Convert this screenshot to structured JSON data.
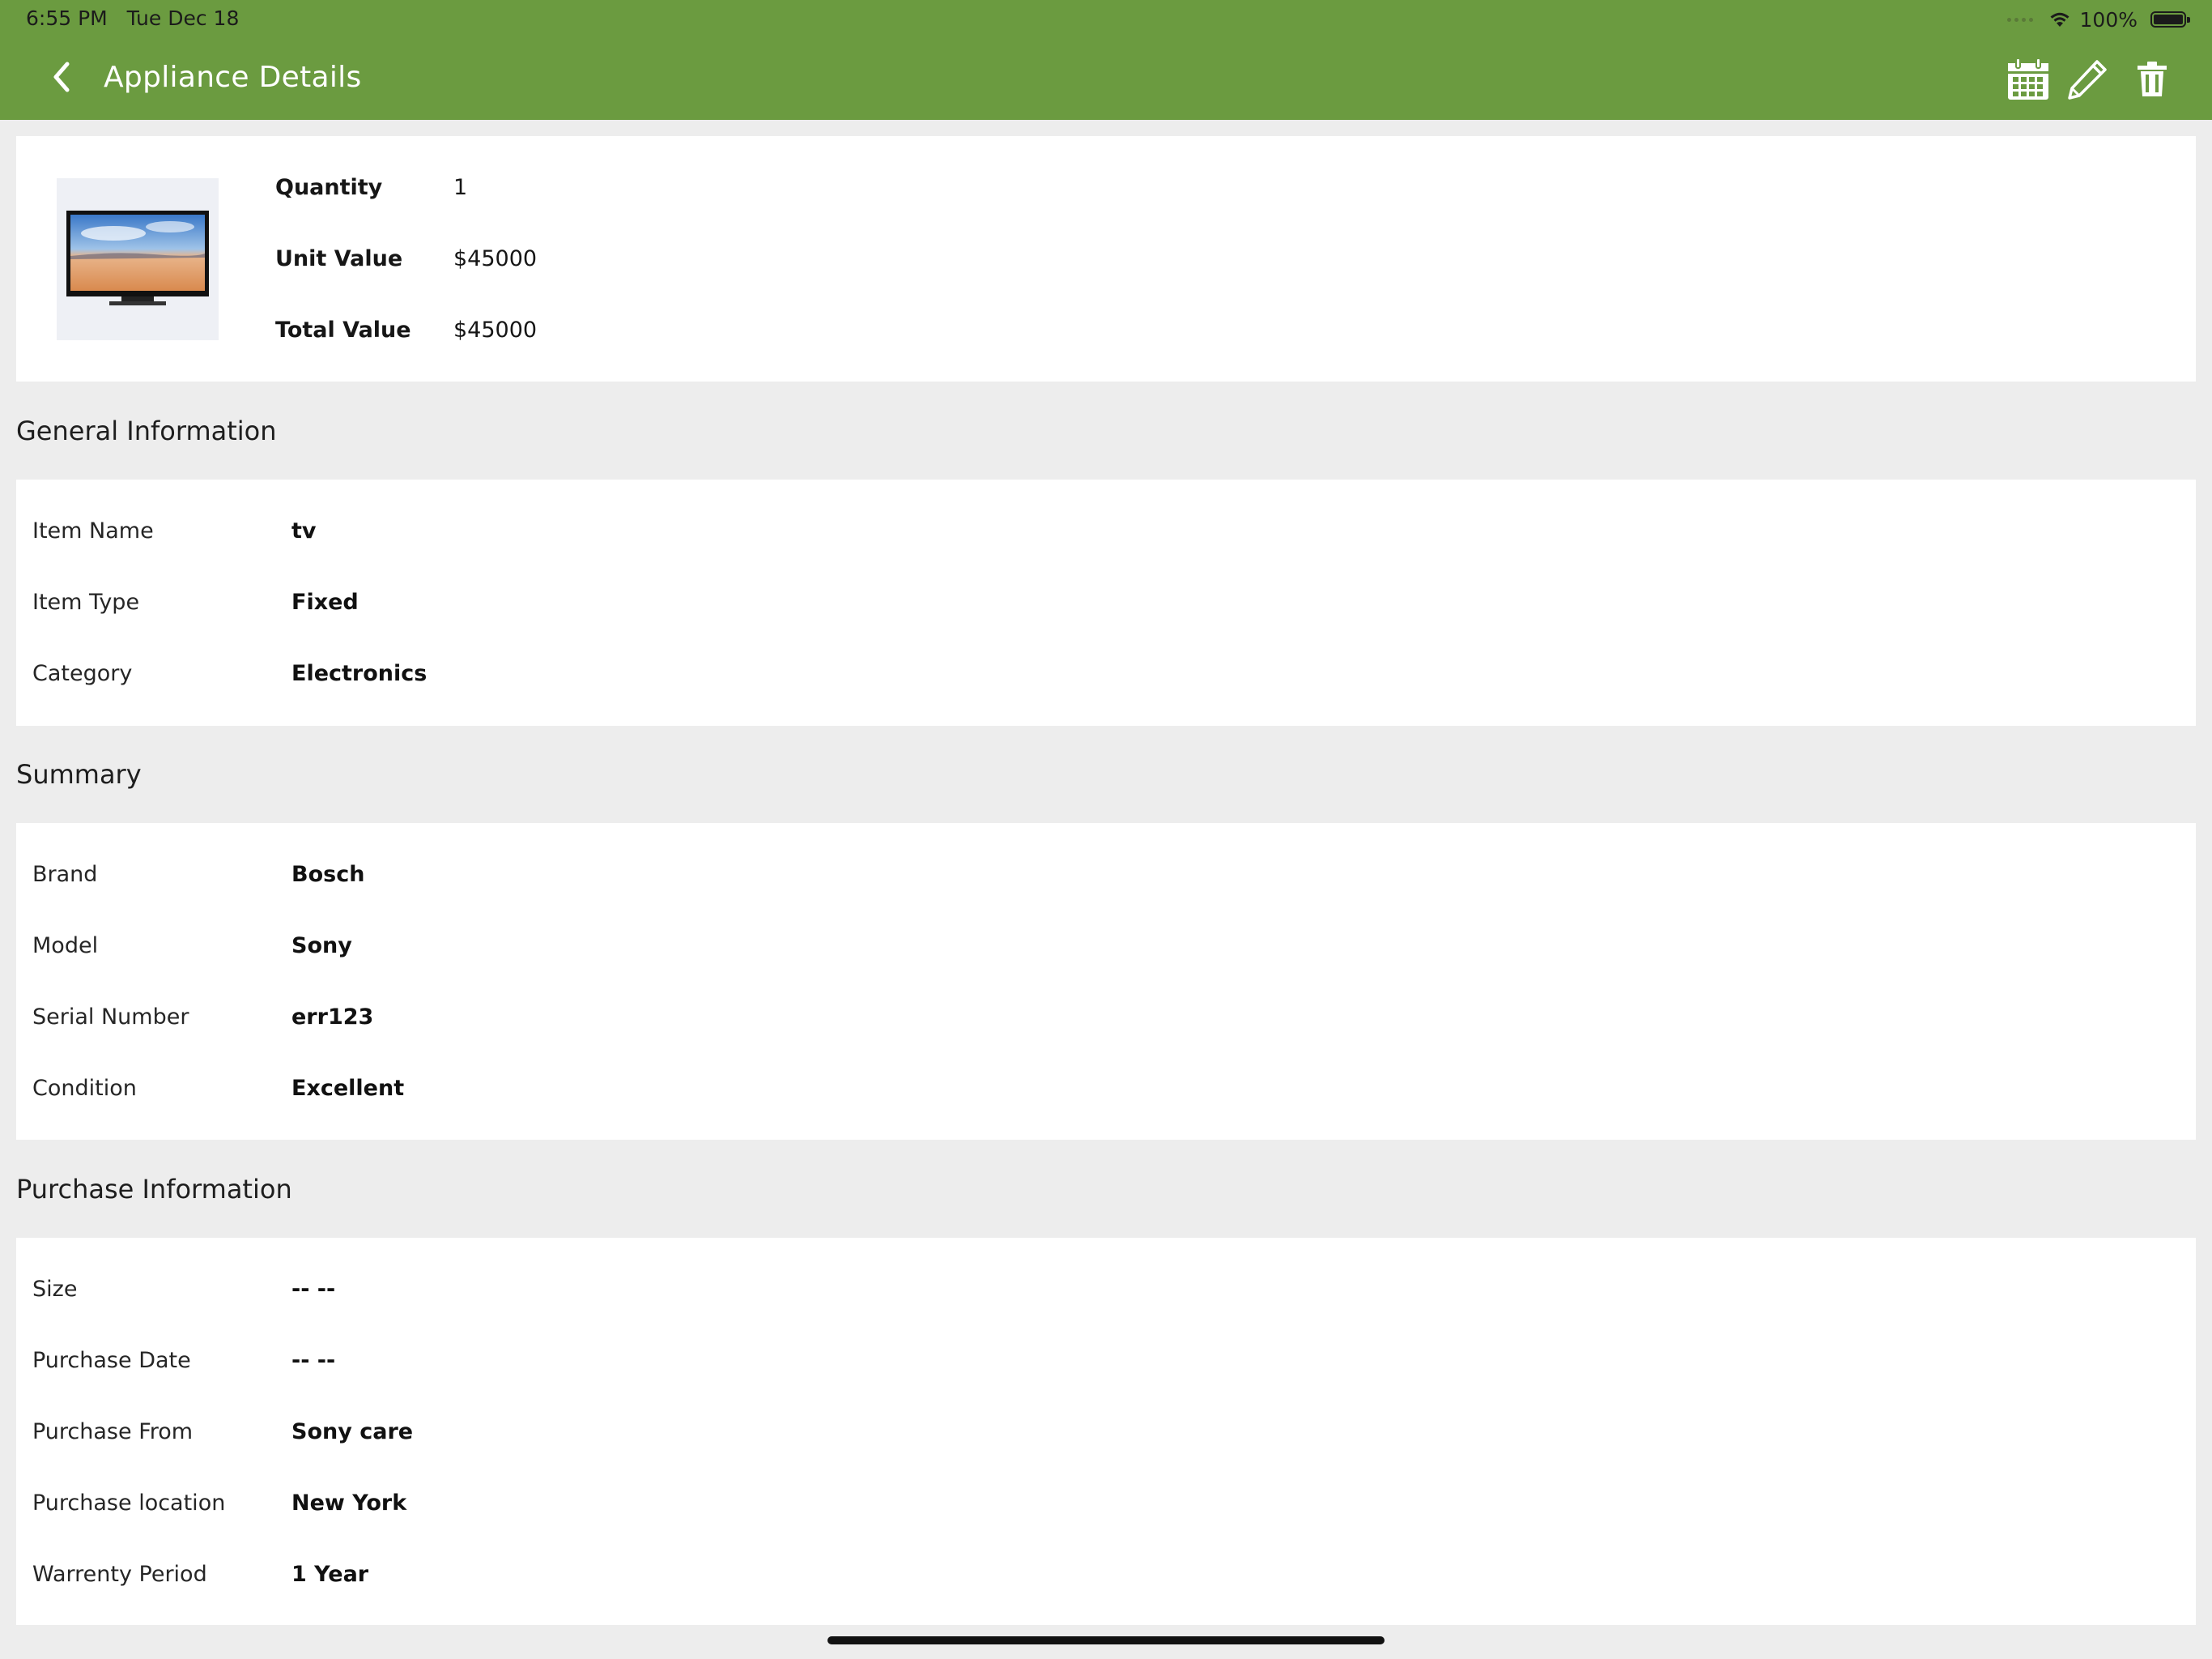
{
  "status_bar": {
    "time": "6:55 PM   Tue Dec 18",
    "battery": "100%"
  },
  "header": {
    "title": "Appliance Details"
  },
  "icons": {
    "back": "chevron-left-icon",
    "calendar": "calendar-icon",
    "edit": "pencil-icon",
    "delete": "trash-icon"
  },
  "colors": {
    "header": "#6b9b40",
    "background": "#ededed",
    "card": "#ffffff"
  },
  "overview": {
    "image": "tv-thumbnail",
    "rows": [
      {
        "label": "Quantity",
        "value": "1"
      },
      {
        "label": "Unit Value",
        "value": "$45000"
      },
      {
        "label": "Total Value",
        "value": "$45000"
      }
    ]
  },
  "general": {
    "title": "General Information",
    "rows": [
      {
        "label": "Item Name",
        "value": "tv"
      },
      {
        "label": "Item Type",
        "value": "Fixed"
      },
      {
        "label": "Category",
        "value": "Electronics"
      }
    ]
  },
  "summary": {
    "title": "Summary",
    "rows": [
      {
        "label": "Brand",
        "value": "Bosch"
      },
      {
        "label": "Model",
        "value": "Sony"
      },
      {
        "label": "Serial Number",
        "value": "err123"
      },
      {
        "label": "Condition",
        "value": "Excellent"
      }
    ]
  },
  "purchase": {
    "title": "Purchase Information",
    "rows": [
      {
        "label": "Size",
        "value": "-- --"
      },
      {
        "label": "Purchase Date",
        "value": "-- --"
      },
      {
        "label": "Purchase From",
        "value": "Sony care"
      },
      {
        "label": "Purchase location",
        "value": "New York"
      },
      {
        "label": "Warrenty Period",
        "value": "1 Year"
      }
    ]
  }
}
